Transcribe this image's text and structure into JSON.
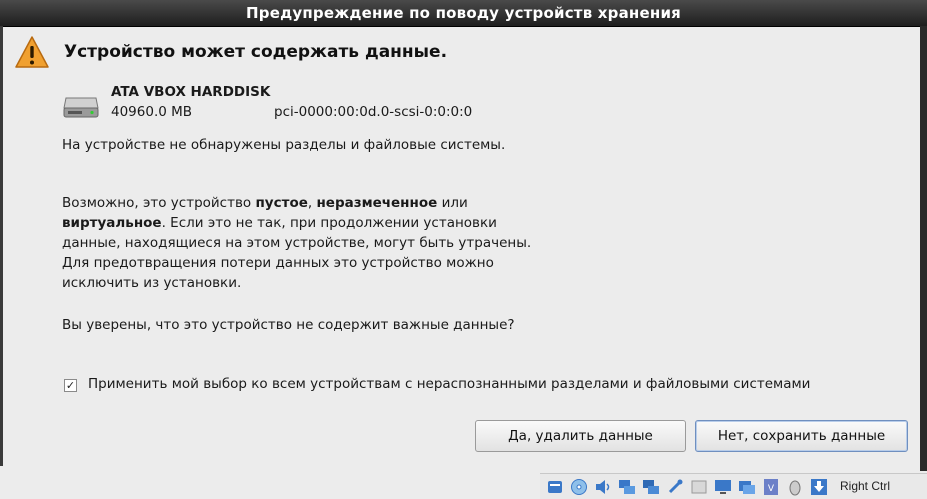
{
  "window": {
    "title": "Предупреждение по поводу устройств хранения"
  },
  "dialog": {
    "heading": "Устройство может содержать данные.",
    "device": {
      "name": "ATA VBOX HARDDISK",
      "size": "40960.0 MB",
      "path": "pci-0000:00:0d.0-scsi-0:0:0:0"
    },
    "paragraph1": "На устройстве не обнаружены разделы и файловые системы.",
    "paragraph2": {
      "part1": "Возможно, это устройство ",
      "bold1": "пустое",
      "part2": ", ",
      "bold2": "неразмеченное",
      "part3": " или ",
      "bold3": "виртуальное",
      "part4": ". Если это не так, при продолжении установки данные, находящиеся на этом устройстве, могут быть утрачены. Для предотвращения потери данных это устройство можно исключить из установки."
    },
    "paragraph3": "Вы уверены, что это устройство не содержит важные данные?",
    "apply_all": {
      "label": "Применить мой выбор ко всем устройствам с нераспознанными разделами и файловыми системами",
      "checked": true,
      "mark": "✓"
    },
    "buttons": {
      "delete": "Да, удалить данные",
      "keep": "Нет, сохранить данные"
    }
  },
  "statusbar": {
    "icons": [
      "disk-activity-icon",
      "optical-drive-icon",
      "audio-icon",
      "network-icon",
      "shared-network-icon",
      "usb-icon",
      "shared-folders-icon",
      "display-icon",
      "capture-icon",
      "virtualization-icon",
      "mouse-icon",
      "keyboard-capture-icon"
    ],
    "host_key": "Right Ctrl"
  },
  "colors": {
    "titlebar": "#2b2b2b",
    "warning": "#f0a030",
    "dialog_bg": "#ececec"
  }
}
